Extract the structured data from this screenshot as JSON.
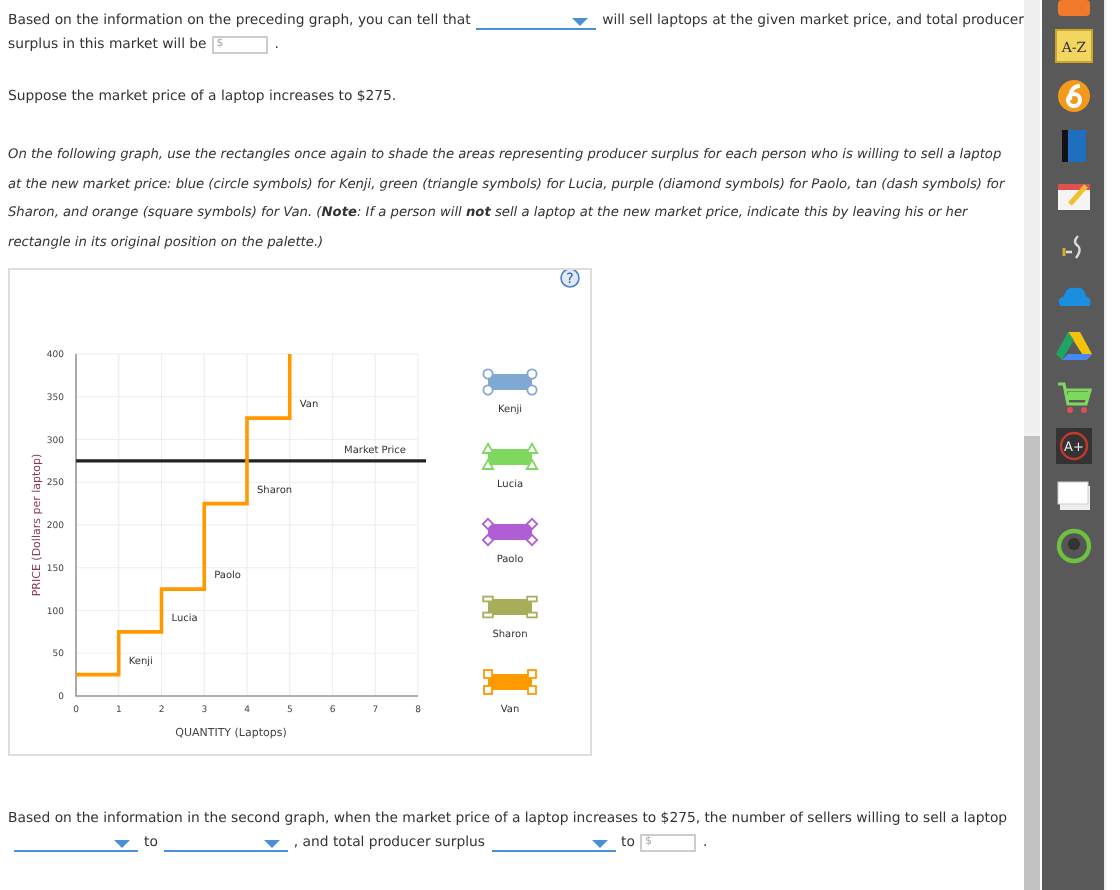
{
  "question1": {
    "before": "Based on the information on the preceding graph, you can tell that",
    "after": "will sell laptops at the given market price, and total producer",
    "line2": "surplus in this market will be",
    "input_placeholder": "$",
    "end": "."
  },
  "scenario": "Suppose the market price of a laptop increases to $275.",
  "instructions": "On the following graph, use the rectangles once again to shade the areas representing producer surplus for each person who is willing to sell a laptop at the new market price: blue (circle symbols) for Kenji, green (triangle symbols) for Lucia, purple (diamond symbols) for Paolo, tan (dash symbols) for Sharon, and orange (square symbols) for Van. (**Note**: *If a person will* **not** *sell a laptop at the new market price, indicate this by leaving his or her rectangle in its original position on the palette.*)",
  "help_label": "?",
  "chart_data": {
    "type": "line",
    "xlabel": "QUANTITY (Laptops)",
    "ylabel": "PRICE (Dollars per laptop)",
    "x": [
      0,
      1,
      1,
      2,
      2,
      3,
      3,
      4,
      4,
      5,
      5
    ],
    "series": [
      {
        "color": "#ff9900",
        "values": [
          25,
          25,
          75,
          75,
          125,
          125,
          225,
          225,
          325,
          325,
          400
        ]
      }
    ],
    "xlim": [
      0,
      8
    ],
    "ylim": [
      0,
      400
    ],
    "xticks": [
      0,
      1,
      2,
      3,
      4,
      5,
      6,
      7,
      8
    ],
    "yticks": [
      0,
      50,
      100,
      150,
      200,
      250,
      300,
      350,
      400
    ],
    "grid": true,
    "ref_lines": [
      {
        "axis": "y",
        "value": 275,
        "label": "Market Price",
        "color": "#222222"
      }
    ],
    "annotations": [
      {
        "text": "Kenji",
        "x": 1,
        "y": 38
      },
      {
        "text": "Lucia",
        "x": 2,
        "y": 88
      },
      {
        "text": "Paolo",
        "x": 3,
        "y": 138
      },
      {
        "text": "Sharon",
        "x": 4,
        "y": 238
      },
      {
        "text": "Van",
        "x": 5,
        "y": 338
      }
    ]
  },
  "palette": [
    {
      "name": "Kenji",
      "color": "#7fa8d4",
      "kind": "circle"
    },
    {
      "name": "Lucia",
      "color": "#7ed85f",
      "kind": "triangle"
    },
    {
      "name": "Paolo",
      "color": "#b05ed6",
      "kind": "diamond"
    },
    {
      "name": "Sharon",
      "color": "#a8ad5a",
      "kind": "dash"
    },
    {
      "name": "Van",
      "color": "#ff9900",
      "kind": "square"
    }
  ],
  "question2": {
    "line1": "Based on the information in the second graph, when the market price of a laptop increases to $275, the number of sellers willing to sell a laptop",
    "to1": "to",
    "mid": ", and total producer surplus",
    "to2": "to",
    "input_placeholder": "$",
    "end": "."
  },
  "toolbar": {
    "dictionary_label": "A-Z",
    "grade_label": "A+"
  }
}
